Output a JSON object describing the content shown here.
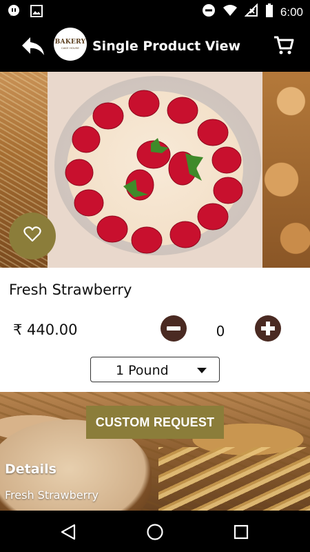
{
  "status_bar": {
    "time": "6:00",
    "icons": [
      "message-icon",
      "image-icon",
      "dnd-icon",
      "wifi-icon",
      "signal-icon",
      "battery-icon"
    ]
  },
  "app_bar": {
    "title": "Single Product View",
    "logo_text": "BAKERY",
    "logo_subtext": "CAKE HOUSE",
    "back_icon": "reply-arrow-icon",
    "cart_icon": "cart-icon"
  },
  "product": {
    "name": "Fresh Strawberry",
    "price": "₹ 440.00",
    "quantity": "0",
    "size_selected": "1 Pound",
    "favorite_icon": "heart-outline-icon"
  },
  "actions": {
    "custom_request_label": "CUSTOM REQUEST"
  },
  "details": {
    "title": "Details",
    "text": "Fresh Strawberry"
  },
  "nav_bar": {
    "icons": [
      "back-triangle-icon",
      "home-circle-icon",
      "recents-square-icon"
    ]
  },
  "colors": {
    "accent": "#8b7d3a",
    "qty_button": "#4a2a22",
    "bar_background": "#000000"
  }
}
